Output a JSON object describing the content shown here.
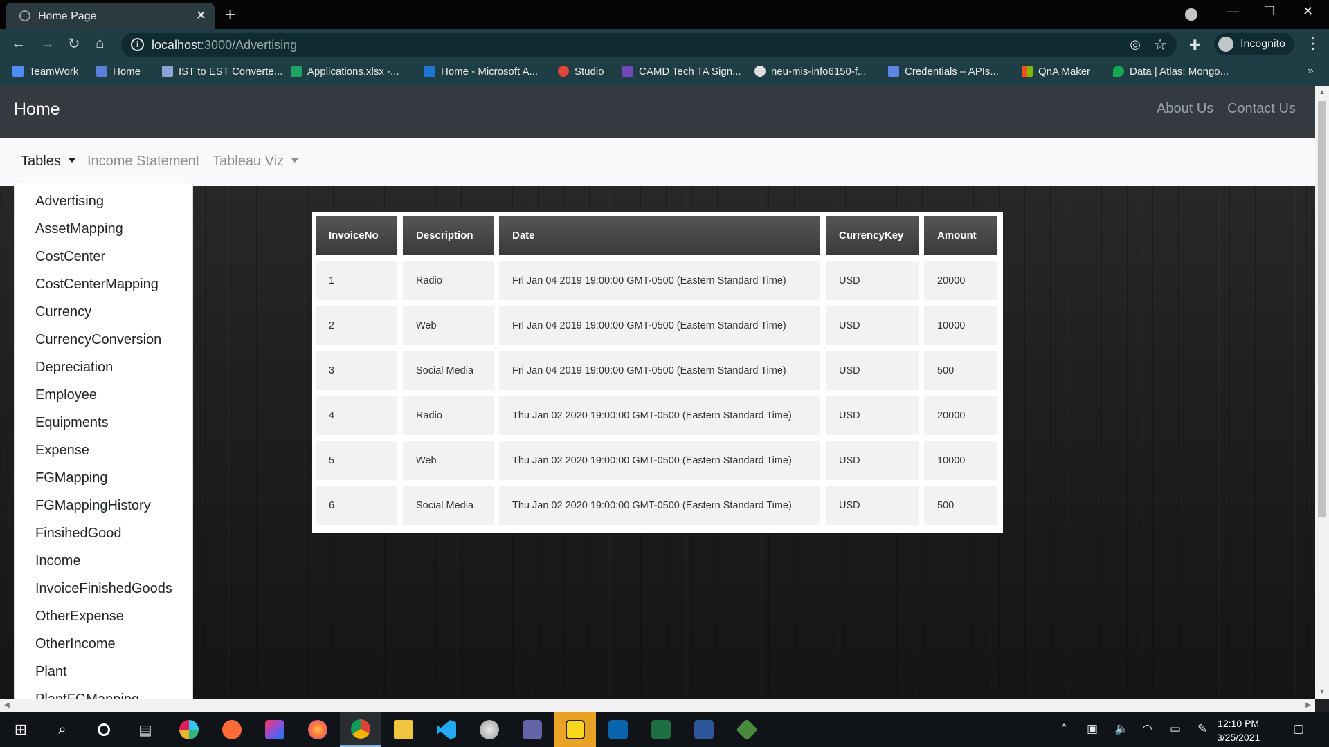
{
  "browser": {
    "tab_title": "Home Page",
    "url_host": "localhost",
    "url_path": ":3000/Advertising",
    "profile_label": "Incognito"
  },
  "bookmarks": [
    {
      "label": "TeamWork",
      "color": "#4f8df5"
    },
    {
      "label": "Home",
      "color": "#5b7fd8"
    },
    {
      "label": "IST to EST Converte...",
      "color": "#8aa4d6"
    },
    {
      "label": "Applications.xlsx -...",
      "color": "#1fa463"
    },
    {
      "label": "Home - Microsoft A...",
      "color": "#1d76d2"
    },
    {
      "label": "Studio",
      "color": "#e0473a"
    },
    {
      "label": "CAMD Tech TA Sign...",
      "color": "#7248b9"
    },
    {
      "label": "neu-mis-info6150-f...",
      "color": "#dddddd"
    },
    {
      "label": "Credentials – APIs...",
      "color": "#5b86e5"
    },
    {
      "label": "QnA Maker",
      "color": "#f25022"
    },
    {
      "label": "Data | Atlas: Mongo...",
      "color": "#13aa52"
    }
  ],
  "site": {
    "brand": "Home",
    "nav_links": [
      "About Us",
      "Contact Us"
    ],
    "subnav": {
      "tables": "Tables",
      "income_statement": "Income Statement",
      "tableau_viz": "Tableau Viz"
    },
    "dropdown_items": [
      "Advertising",
      "AssetMapping",
      "CostCenter",
      "CostCenterMapping",
      "Currency",
      "CurrencyConversion",
      "Depreciation",
      "Employee",
      "Equipments",
      "Expense",
      "FGMapping",
      "FGMappingHistory",
      "FinsihedGood",
      "Income",
      "InvoiceFinishedGoods",
      "OtherExpense",
      "OtherIncome",
      "Plant",
      "PlantFGMapping"
    ]
  },
  "table": {
    "headers": [
      "InvoiceNo",
      "Description",
      "Date",
      "CurrencyKey",
      "Amount"
    ],
    "rows": [
      [
        "1",
        "Radio",
        "Fri Jan 04 2019 19:00:00 GMT-0500 (Eastern Standard Time)",
        "USD",
        "20000"
      ],
      [
        "2",
        "Web",
        "Fri Jan 04 2019 19:00:00 GMT-0500 (Eastern Standard Time)",
        "USD",
        "10000"
      ],
      [
        "3",
        "Social Media",
        "Fri Jan 04 2019 19:00:00 GMT-0500 (Eastern Standard Time)",
        "USD",
        "500"
      ],
      [
        "4",
        "Radio",
        "Thu Jan 02 2020 19:00:00 GMT-0500 (Eastern Standard Time)",
        "USD",
        "20000"
      ],
      [
        "5",
        "Web",
        "Thu Jan 02 2020 19:00:00 GMT-0500 (Eastern Standard Time)",
        "USD",
        "10000"
      ],
      [
        "6",
        "Social Media",
        "Thu Jan 02 2020 19:00:00 GMT-0500 (Eastern Standard Time)",
        "USD",
        "500"
      ]
    ]
  },
  "taskbar": {
    "apps": [
      {
        "name": "windows-start-icon",
        "color": "#ffffff"
      },
      {
        "name": "search-icon",
        "color": "#ffffff"
      },
      {
        "name": "cortana-icon",
        "color": "#ffffff"
      },
      {
        "name": "task-view-icon",
        "color": "#ffffff"
      },
      {
        "name": "slack-icon",
        "color": "#e01e5a"
      },
      {
        "name": "postman-icon",
        "color": "#ff6c37"
      },
      {
        "name": "intellij-icon",
        "color": "#8d4fdb"
      },
      {
        "name": "firefox-icon",
        "color": "#ff7139"
      },
      {
        "name": "chrome-icon",
        "color": "#4285f4"
      },
      {
        "name": "file-explorer-icon",
        "color": "#f0c43c"
      },
      {
        "name": "vscode-icon",
        "color": "#23a9f2"
      },
      {
        "name": "paint-icon",
        "color": "#c9c9c9"
      },
      {
        "name": "teams-icon",
        "color": "#6264a7"
      },
      {
        "name": "sticky-notes-icon",
        "color": "#f9d71c"
      },
      {
        "name": "outlook-icon",
        "color": "#0a64ad"
      },
      {
        "name": "excel-icon",
        "color": "#1d6f42"
      },
      {
        "name": "word-icon",
        "color": "#2b579a"
      },
      {
        "name": "git-icon",
        "color": "#4a8a3c"
      }
    ],
    "time": "12:10 PM",
    "date": "3/25/2021"
  }
}
